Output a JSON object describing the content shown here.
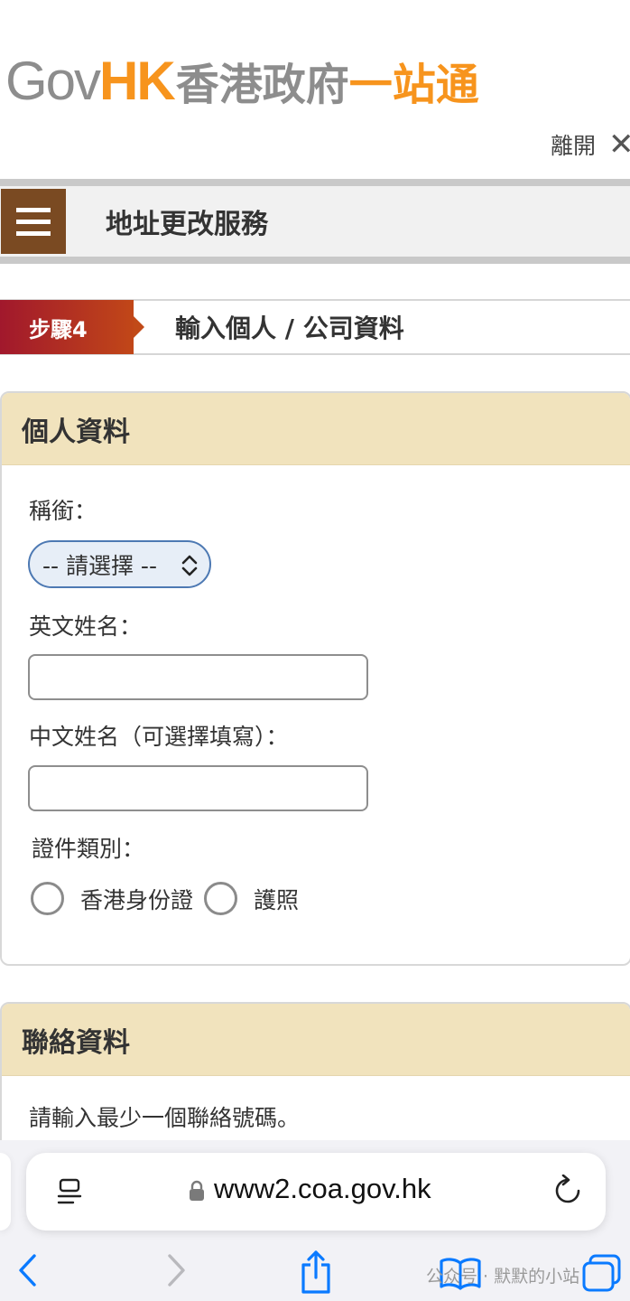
{
  "header": {
    "logo_gov": "Gov",
    "logo_hk": "HK",
    "logo_cn_gray": "香港政府",
    "logo_cn_orange": "一站通",
    "exit_label": "離開",
    "exit_icon": "close-icon"
  },
  "service": {
    "title": "地址更改服務",
    "menu_icon": "hamburger-menu-icon"
  },
  "step": {
    "badge": "步驟4",
    "title": "輸入個人 / 公司資料"
  },
  "personal": {
    "heading": "個人資料",
    "title_label": "稱銜：",
    "title_select_value": "-- 請選擇 --",
    "english_name_label": "英文姓名：",
    "english_name_value": "",
    "chinese_name_label": "中文姓名（可選擇填寫）：",
    "chinese_name_value": "",
    "id_type_label": "證件類別：",
    "id_options": [
      "香港身份證",
      "護照"
    ]
  },
  "contact": {
    "heading": "聯絡資料",
    "hint": "請輸入最少一個聯絡號碼。"
  },
  "browser": {
    "url": "www2.coa.gov.hk",
    "watermark": "公众号 · 默默的小站"
  },
  "colors": {
    "brand_orange": "#f7941d",
    "menu_brown": "#7a4a22",
    "step_red": "#a1182c",
    "card_header": "#f1e3bd",
    "select_border": "#4d79b3",
    "ios_blue": "#0a7aff"
  }
}
